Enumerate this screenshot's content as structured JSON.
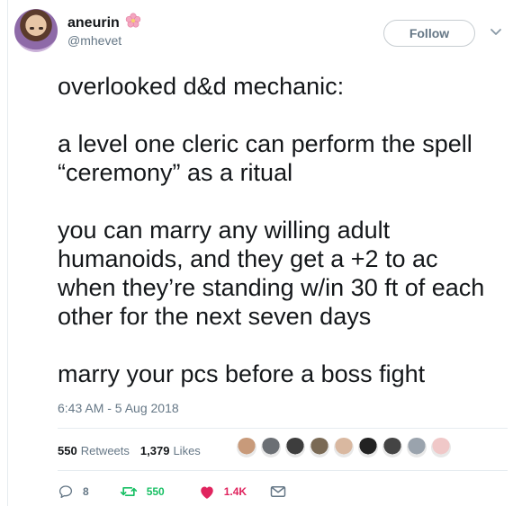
{
  "user": {
    "display_name": "aneurin",
    "handle": "@mhevet",
    "flower_emoji": "🌸"
  },
  "follow_label": "Follow",
  "tweet": {
    "paragraphs": [
      "overlooked d&d mechanic:",
      "a level one cleric can perform the spell\n“ceremony” as a ritual",
      "you can marry any willing adult\nhumanoids, and they get a +2 to ac\nwhen they’re standing w/in 30 ft of each\nother for the next seven days",
      "marry your pcs before a boss fight"
    ],
    "timestamp": "6:43 AM - 5 Aug 2018"
  },
  "stats": {
    "retweets_count": "550",
    "retweets_label": "Retweets",
    "likes_count": "1,379",
    "likes_label": "Likes"
  },
  "liker_colors": [
    "#c89a7a",
    "#6b6f74",
    "#3d3d3d",
    "#7a6a55",
    "#d9b8a0",
    "#222222",
    "#444444",
    "#9aa3ad",
    "#f0c8c8"
  ],
  "actions": {
    "reply_count": "8",
    "retweet_count": "550",
    "like_count": "1.4K"
  },
  "colors": {
    "retweet": "#17bf63",
    "like": "#e0245e",
    "muted": "#657786"
  }
}
